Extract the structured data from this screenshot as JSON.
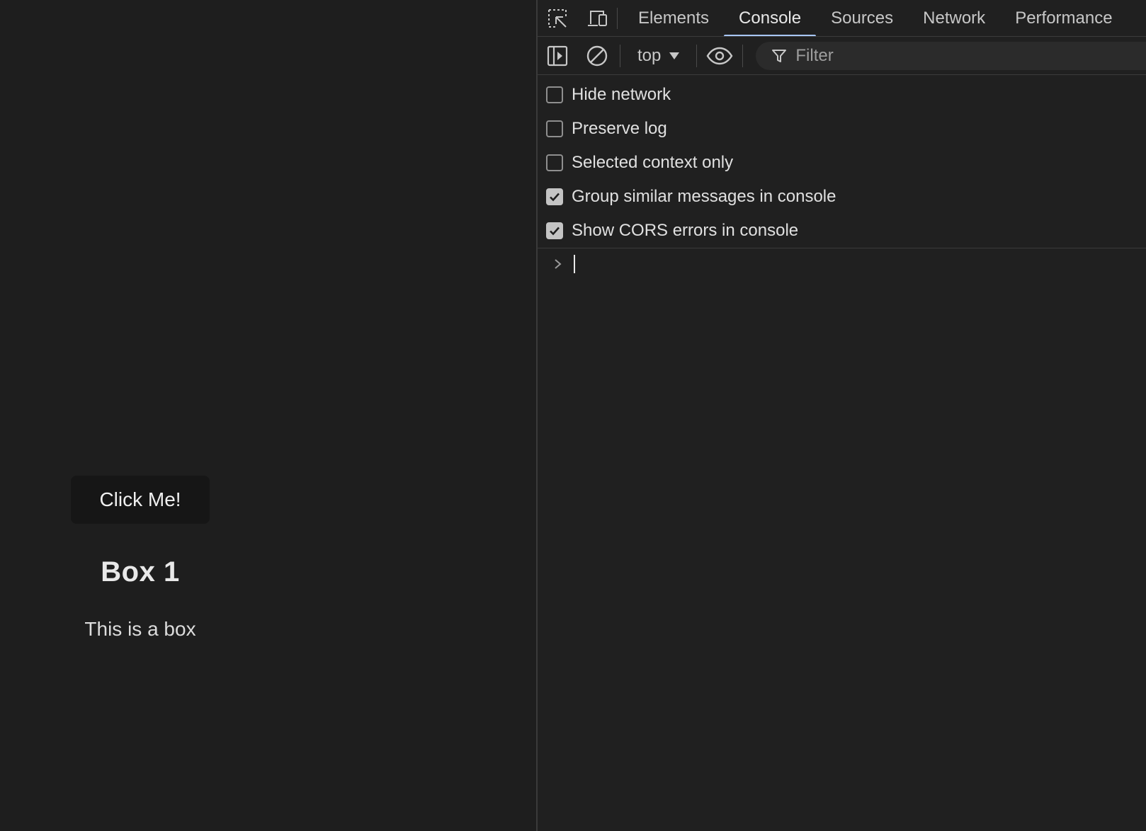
{
  "page": {
    "button_label": "Click Me!",
    "box_title": "Box 1",
    "box_text": "This is a box"
  },
  "devtools": {
    "toolbar_icons": [
      "inspect-element-icon",
      "device-toolbar-icon"
    ],
    "tabs": [
      {
        "label": "Elements",
        "active": false
      },
      {
        "label": "Console",
        "active": true
      },
      {
        "label": "Sources",
        "active": false
      },
      {
        "label": "Network",
        "active": false
      },
      {
        "label": "Performance",
        "active": false
      }
    ],
    "console_toolbar": {
      "context": "top",
      "filter_placeholder": "Filter",
      "icons": [
        "sidebar-toggle-icon",
        "clear-console-icon",
        "live-expression-eye-icon",
        "filter-icon"
      ]
    },
    "settings": [
      {
        "label": "Hide network",
        "checked": false
      },
      {
        "label": "Preserve log",
        "checked": false
      },
      {
        "label": "Selected context only",
        "checked": false
      },
      {
        "label": "Group similar messages in console",
        "checked": true
      },
      {
        "label": "Show CORS errors in console",
        "checked": true
      }
    ]
  },
  "colors": {
    "background": "#1e1e1e",
    "active_tab_underline": "#a8c7fa",
    "checkbox_checked": "#c4c4c4"
  }
}
